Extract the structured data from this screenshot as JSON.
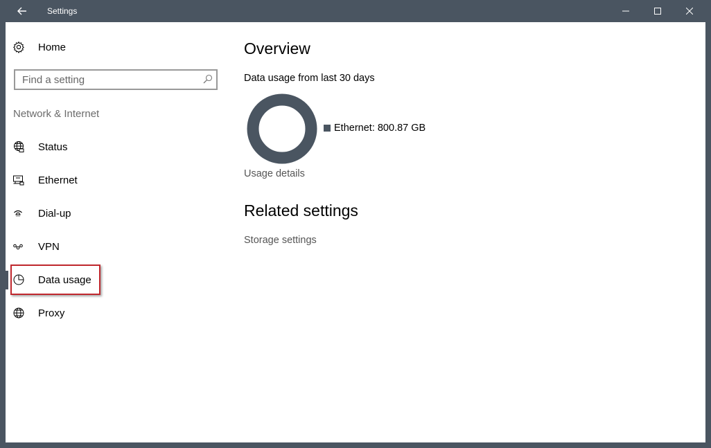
{
  "window": {
    "title": "Settings",
    "accent_color": "#4a5561"
  },
  "sidebar": {
    "home_label": "Home",
    "search_placeholder": "Find a setting",
    "section_heading": "Network & Internet",
    "items": [
      {
        "label": "Status",
        "icon": "globe-network-icon"
      },
      {
        "label": "Ethernet",
        "icon": "ethernet-icon"
      },
      {
        "label": "Dial-up",
        "icon": "dial-up-icon"
      },
      {
        "label": "VPN",
        "icon": "vpn-icon"
      },
      {
        "label": "Data usage",
        "icon": "pie-chart-icon",
        "selected": true
      },
      {
        "label": "Proxy",
        "icon": "globe-icon"
      }
    ]
  },
  "main": {
    "overview_title": "Overview",
    "usage_subtitle": "Data usage from last 30 days",
    "legend_label": "Ethernet: 800.87 GB",
    "usage_details_link": "Usage details",
    "related_title": "Related settings",
    "storage_link": "Storage settings"
  },
  "chart_data": {
    "type": "pie",
    "categories": [
      "Ethernet"
    ],
    "values": [
      800.87
    ],
    "unit": "GB",
    "colors": [
      "#4a5561"
    ]
  }
}
